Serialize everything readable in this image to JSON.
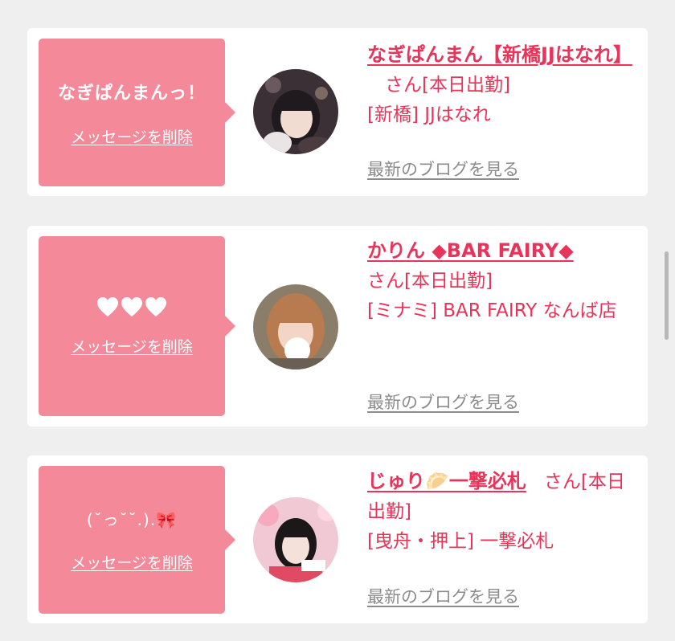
{
  "cards": [
    {
      "message": "なぎぱんまんっ！",
      "delete_label": "メッセージを削除",
      "name": "なぎぱんまん【新橋JJはなれ】",
      "san_status": "さん[本日出勤]",
      "shop": "[新橋] JJはなれ",
      "blog_label": "最新のブログを見る"
    },
    {
      "message": "🤍🤍🤍",
      "delete_label": "メッセージを削除",
      "name": "かりん ◆BAR FAIRY◆",
      "san_status": "さん[本日出勤]",
      "shop": "[ミナミ] BAR FAIRY なんば店",
      "blog_label": "最新のブログを見る"
    },
    {
      "message": "(˘っ˘˘.).🎀",
      "delete_label": "メッセージを削除",
      "name": "じゅり🥟一撃必札",
      "san_status": "さん[本日出勤]",
      "shop": "[曳舟・押上] 一撃必札",
      "blog_label": "最新のブログを見る"
    }
  ],
  "colors": {
    "accent": "#e8345a",
    "bubble": "#f4899a",
    "muted": "#8c8c8c",
    "background": "#efefef"
  }
}
